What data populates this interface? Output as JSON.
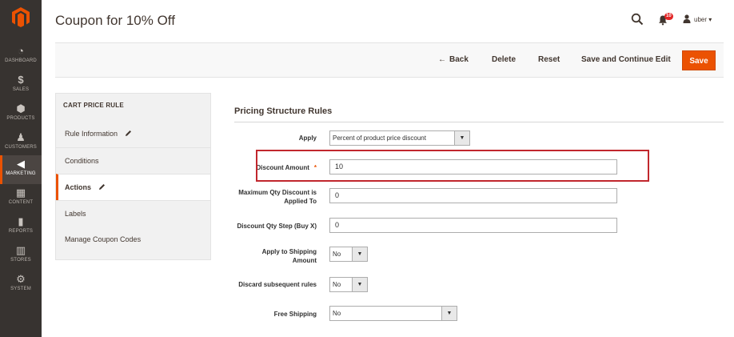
{
  "colors": {
    "accent": "#eb5202",
    "nav_bg": "#373330",
    "highlight": "#c1272d"
  },
  "nav": {
    "items": [
      {
        "label": "DASHBOARD",
        "icon": "dashboard-icon"
      },
      {
        "label": "SALES",
        "icon": "dollar-icon"
      },
      {
        "label": "PRODUCTS",
        "icon": "cube-icon"
      },
      {
        "label": "CUSTOMERS",
        "icon": "person-icon"
      },
      {
        "label": "MARKETING",
        "icon": "megaphone-icon",
        "active": true
      },
      {
        "label": "CONTENT",
        "icon": "layout-icon"
      },
      {
        "label": "REPORTS",
        "icon": "bar-chart-icon"
      },
      {
        "label": "STORES",
        "icon": "store-icon"
      },
      {
        "label": "SYSTEM",
        "icon": "gear-icon"
      }
    ]
  },
  "header": {
    "title": "Coupon for 10% Off",
    "notifications_count": "10",
    "user": "uber ▾"
  },
  "actions": {
    "back": "Back",
    "delete": "Delete",
    "reset": "Reset",
    "save_continue": "Save and Continue Edit",
    "save": "Save"
  },
  "tabs": {
    "title": "CART PRICE RULE",
    "items": [
      {
        "label": "Rule Information"
      },
      {
        "label": "Conditions"
      },
      {
        "label": "Actions"
      },
      {
        "label": "Labels"
      },
      {
        "label": "Manage Coupon Codes"
      }
    ]
  },
  "form": {
    "section_title": "Pricing Structure Rules",
    "apply": {
      "label": "Apply",
      "value": "Percent of product price discount"
    },
    "discount_amount": {
      "label": "Discount Amount",
      "required": "*",
      "value": "10"
    },
    "max_qty": {
      "label": "Maximum Qty Discount is Applied To",
      "value": "0"
    },
    "qty_step": {
      "label": "Discount Qty Step (Buy X)",
      "value": "0"
    },
    "apply_shipping": {
      "label": "Apply to Shipping Amount",
      "value": "No"
    },
    "discard_rules": {
      "label": "Discard subsequent rules",
      "value": "No"
    },
    "free_shipping": {
      "label": "Free Shipping",
      "value": "No"
    }
  }
}
